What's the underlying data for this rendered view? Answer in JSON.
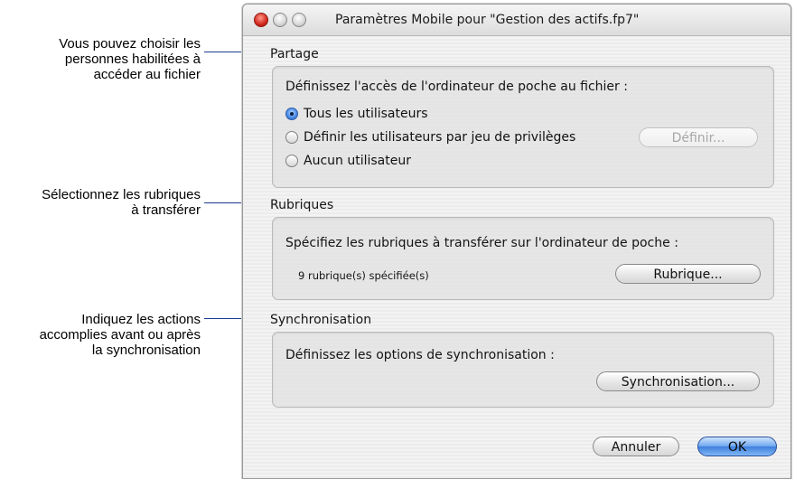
{
  "callouts": [
    {
      "lines": [
        "Vous pouvez choisir les",
        "personnes habilitées à",
        "accéder au fichier"
      ]
    },
    {
      "lines": [
        "Sélectionnez les rubriques",
        "à transférer"
      ]
    },
    {
      "lines": [
        "Indiquez les actions",
        "accomplies avant ou après",
        "la synchronisation"
      ]
    }
  ],
  "window": {
    "title": "Paramètres Mobile pour \"Gestion des actifs.fp7\""
  },
  "sharing": {
    "section_label": "Partage",
    "prompt": "Définissez l'accès de l'ordinateur de poche au fichier :",
    "options": [
      {
        "label": "Tous les utilisateurs",
        "selected": true
      },
      {
        "label": "Définir les utilisateurs par jeu de privilèges",
        "selected": false
      },
      {
        "label": "Aucun utilisateur",
        "selected": false
      }
    ],
    "define_button": "Définir..."
  },
  "fields": {
    "section_label": "Rubriques",
    "prompt": "Spécifiez les rubriques à transférer sur l'ordinateur de poche :",
    "count_text": "9 rubrique(s) spécifiée(s)",
    "button": "Rubrique..."
  },
  "sync": {
    "section_label": "Synchronisation",
    "prompt": "Définissez les options de synchronisation :",
    "button": "Synchronisation..."
  },
  "footer": {
    "cancel_label": "Annuler",
    "ok_label": "OK"
  },
  "colors": {
    "callout_line": "#1a3c8e",
    "default_button": "#4a8ae4"
  }
}
